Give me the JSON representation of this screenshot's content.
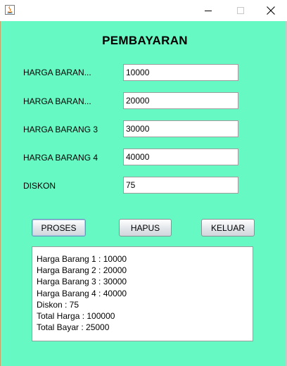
{
  "window": {
    "minimize_glyph": "—",
    "maximize_glyph": "☐",
    "close_glyph": "✕"
  },
  "form": {
    "title": "PEMBAYARAN",
    "fields": [
      {
        "label": "HARGA BARAN...",
        "value": "10000"
      },
      {
        "label": "HARGA BARAN...",
        "value": "20000"
      },
      {
        "label": "HARGA BARANG 3",
        "value": "30000"
      },
      {
        "label": "HARGA BARANG 4",
        "value": "40000"
      },
      {
        "label": "DISKON",
        "value": "75"
      }
    ]
  },
  "buttons": {
    "proses": "PROSES",
    "hapus": "HAPUS",
    "keluar": "KELUAR"
  },
  "output": {
    "lines": [
      "Harga Barang 1 : 10000",
      "Harga Barang 2 : 20000",
      "Harga Barang 3 : 30000",
      "Harga Barang 4 : 40000",
      "Diskon : 75",
      "Total Harga : 100000",
      "Total Bayar : 25000"
    ]
  },
  "colors": {
    "background": "#66f9c4"
  }
}
